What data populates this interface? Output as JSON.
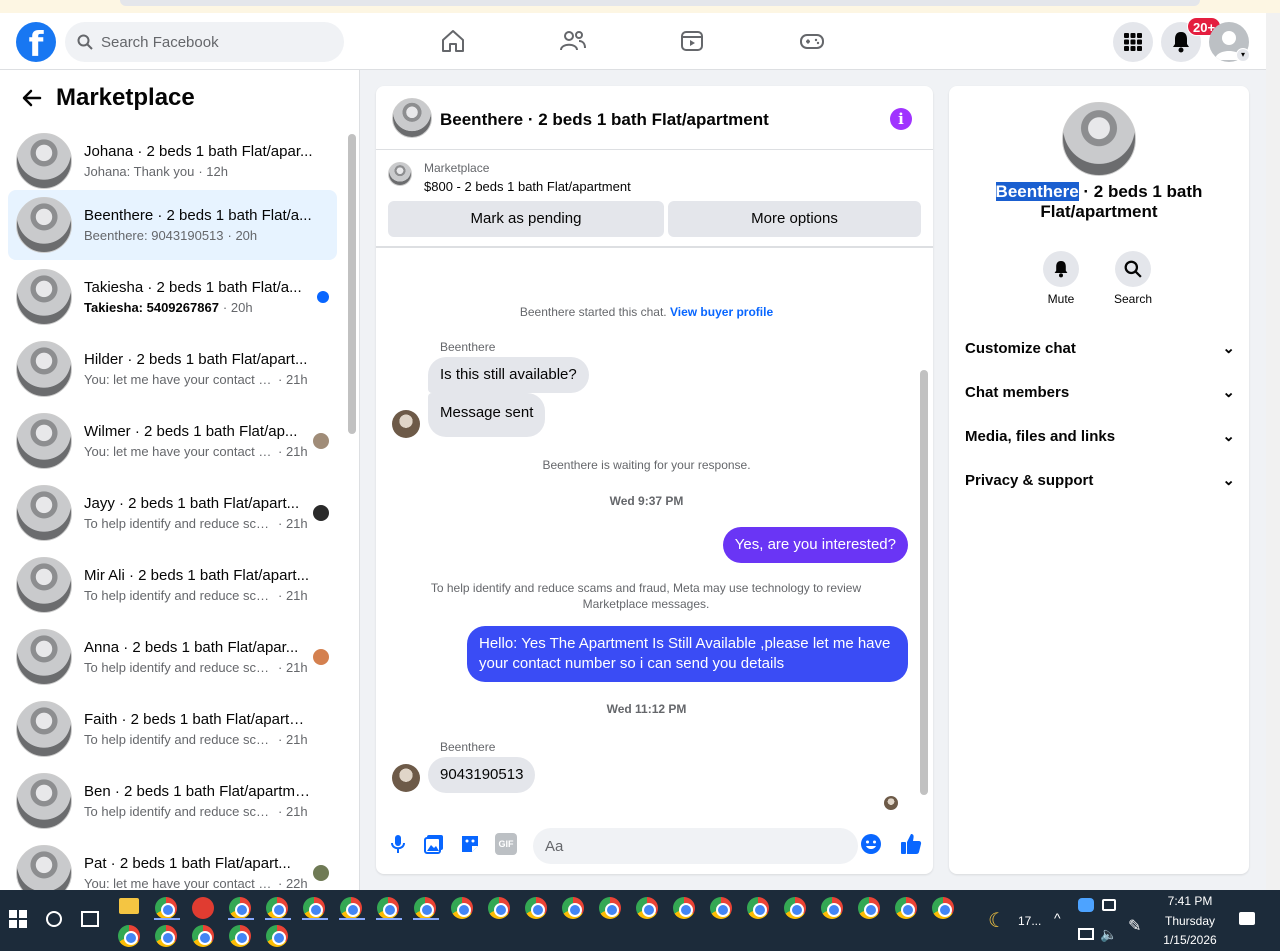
{
  "header": {
    "search_placeholder": "Search Facebook",
    "notification_count": "20+"
  },
  "sidebar": {
    "title": "Marketplace",
    "conversations": [
      {
        "title": "Johana · 2 beds 1 bath Flat/apar...",
        "snippet": "Johana: Thank you",
        "time": "· 12h"
      },
      {
        "title": "Beenthere · 2 beds 1 bath Flat/a...",
        "snippet": "Beenthere: 9043190513",
        "time": "· 20h"
      },
      {
        "title": "Takiesha · 2 beds 1 bath Flat/a...",
        "snippet": "Takiesha: 5409267867",
        "time": "· 20h"
      },
      {
        "title": "Hilder · 2 beds 1 bath Flat/apart...",
        "snippet": "You: let me have your contact nu...",
        "time": "· 21h"
      },
      {
        "title": "Wilmer · 2 beds 1 bath Flat/ap...",
        "snippet": "You: let me have your contact n...",
        "time": "· 21h"
      },
      {
        "title": "Jayy · 2 beds 1 bath Flat/apart...",
        "snippet": "To help identify and reduce sca...",
        "time": "· 21h"
      },
      {
        "title": "Mir Ali · 2 beds 1 bath Flat/apart...",
        "snippet": "To help identify and reduce scams...",
        "time": "· 21h"
      },
      {
        "title": "Anna · 2 beds 1 bath Flat/apar...",
        "snippet": "To help identify and reduce sca...",
        "time": "· 21h"
      },
      {
        "title": "Faith · 2 beds 1 bath Flat/apartm...",
        "snippet": "To help identify and reduce scams...",
        "time": "· 21h"
      },
      {
        "title": "Ben · 2 beds 1 bath Flat/apartme...",
        "snippet": "To help identify and reduce scams...",
        "time": "· 21h"
      },
      {
        "title": "Pat · 2 beds 1 bath Flat/apart...",
        "snippet": "You: let me have your contact n...",
        "time": "· 22h"
      }
    ]
  },
  "chat": {
    "title": "Beenthere · 2 beds 1 bath Flat/apartment",
    "listing_source": "Marketplace",
    "listing_desc": "$800 - 2 beds 1 bath Flat/apartment",
    "mark_pending": "Mark as pending",
    "more_options": "More options",
    "started_text": "Beenthere started this chat.",
    "view_buyer": "View buyer profile",
    "sender_name": "Beenthere",
    "msg1": "Is this still available?",
    "msg2": "Message sent",
    "waiting": "Beenthere is waiting for your response.",
    "ts1": "Wed 9:37 PM",
    "out1": "Yes, are you interested?",
    "scam_notice": "To help identify and reduce scams and fraud, Meta may use technology to review Marketplace messages.",
    "out2": "Hello: Yes The Apartment Is Still Available ,please let me have your contact number so i can send you details",
    "ts2": "Wed 11:12 PM",
    "msg3": "9043190513",
    "input_placeholder": "Aa",
    "gif_label": "GIF"
  },
  "info": {
    "name_highlight": "Beenthere",
    "title_rest": " · 2 beds 1 bath Flat/apartment",
    "mute": "Mute",
    "search": "Search",
    "sections": [
      "Customize chat",
      "Chat members",
      "Media, files and links",
      "Privacy & support"
    ]
  },
  "taskbar": {
    "weather": "17...",
    "time": "7:41 PM",
    "day": "Thursday",
    "date": "1/15/2026"
  },
  "colors": {
    "accent": "#0866ff",
    "out_bubble_top": "#7a2ff7",
    "out_bubble_bottom": "#2e50f5",
    "badge": "#e41e3f",
    "info_icon": "#a033ff"
  }
}
